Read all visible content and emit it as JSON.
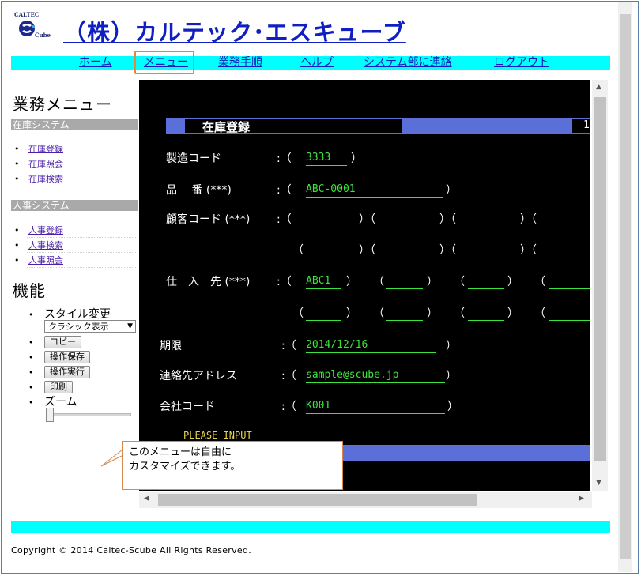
{
  "header": {
    "logo_text_top": "CALTEC",
    "logo_text_bottom": "Cube",
    "company_name": "（株）カルテック･エスキューブ"
  },
  "nav": {
    "items": [
      {
        "label": "ホーム"
      },
      {
        "label": "メニュー"
      },
      {
        "label": "業務手順"
      },
      {
        "label": "ヘルプ"
      },
      {
        "label": "システム部に連絡"
      },
      {
        "label": "ログアウト"
      }
    ]
  },
  "sidebar": {
    "title": "業務メニュー",
    "inventory_system": {
      "label": "在庫システム",
      "items": [
        {
          "label": "在庫登録"
        },
        {
          "label": "在庫照会"
        },
        {
          "label": "在庫検索"
        }
      ]
    },
    "hr_system": {
      "label": "人事システム",
      "items": [
        {
          "label": "人事登録"
        },
        {
          "label": "人事検索"
        },
        {
          "label": "人事照会"
        }
      ]
    },
    "functions": {
      "title": "機能",
      "style_change_label": "スタイル変更",
      "style_select_value": "クラシック表示",
      "copy_button": "コピー",
      "save_op_button": "操作保存",
      "run_op_button": "操作実行",
      "print_button": "印刷",
      "zoom_label": "ズーム",
      "zoom_level": 0
    }
  },
  "terminal": {
    "screen_title": "在庫登録",
    "page_number": "1",
    "labels": {
      "product_code": "製造コード",
      "item_no": "品　 番 (***)",
      "customer_code": "顧客コード (***)",
      "supplier": "仕　入　先 (***)",
      "deadline": "期限",
      "email": "連絡先アドレス",
      "company_code": "会社コード"
    },
    "values": {
      "product_code": "3333",
      "item_no": "ABC-0001",
      "supplier_1": "ABC1",
      "deadline": "2014/12/16",
      "email": "sample@scube.jp",
      "company_code": "K001"
    },
    "colon_paren": ":（",
    "open_paren": "（",
    "close_paren": "）",
    "prompt": "PLEASE INPUT"
  },
  "callout": {
    "line1": "このメニューは自由に",
    "line2": "カスタマイズできます。"
  },
  "footer": {
    "copyright": "Copyright © 2014 Caltec-Scube All Rights Reserved."
  },
  "colors": {
    "accent_cyan": "#00ffff",
    "link_blue": "#1020c0",
    "terminal_bg": "#000000",
    "terminal_value": "#3de33d",
    "terminal_bar": "#5a6fd8",
    "highlight_orange": "#e08a3c"
  }
}
